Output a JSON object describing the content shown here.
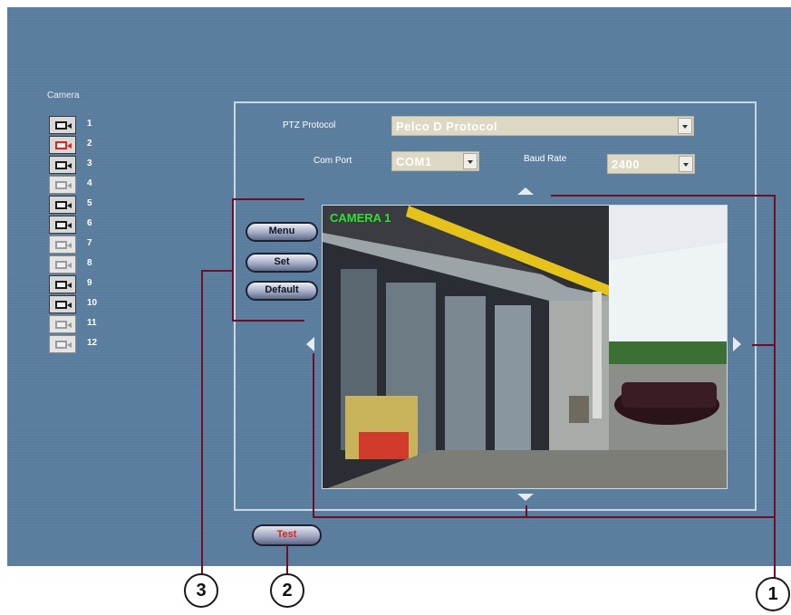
{
  "camera_panel": {
    "title": "Camera",
    "cameras": [
      {
        "num": "1",
        "state": "on"
      },
      {
        "num": "2",
        "state": "selected"
      },
      {
        "num": "3",
        "state": "on"
      },
      {
        "num": "4",
        "state": "off"
      },
      {
        "num": "5",
        "state": "on"
      },
      {
        "num": "6",
        "state": "on"
      },
      {
        "num": "7",
        "state": "off"
      },
      {
        "num": "8",
        "state": "off"
      },
      {
        "num": "9",
        "state": "on"
      },
      {
        "num": "10",
        "state": "on"
      },
      {
        "num": "11",
        "state": "off"
      },
      {
        "num": "12",
        "state": "off"
      }
    ]
  },
  "ptz": {
    "protocol_label": "PTZ Protocol",
    "protocol_value": "Pelco D Protocol",
    "comport_label": "Com Port",
    "comport_value": "COM1",
    "baud_label": "Baud Rate",
    "baud_value": "2400"
  },
  "video": {
    "osd_text": "CAMERA 1"
  },
  "menu_buttons": {
    "menu": "Menu",
    "set": "Set",
    "default": "Default"
  },
  "test_button": "Test",
  "callouts": {
    "one": "1",
    "two": "2",
    "three": "3"
  },
  "colors": {
    "panel_bg": "#5a7d9e",
    "callout_line": "#6e0f2a",
    "selected_camera": "#e0201a",
    "osd_green": "#2fe02f"
  }
}
